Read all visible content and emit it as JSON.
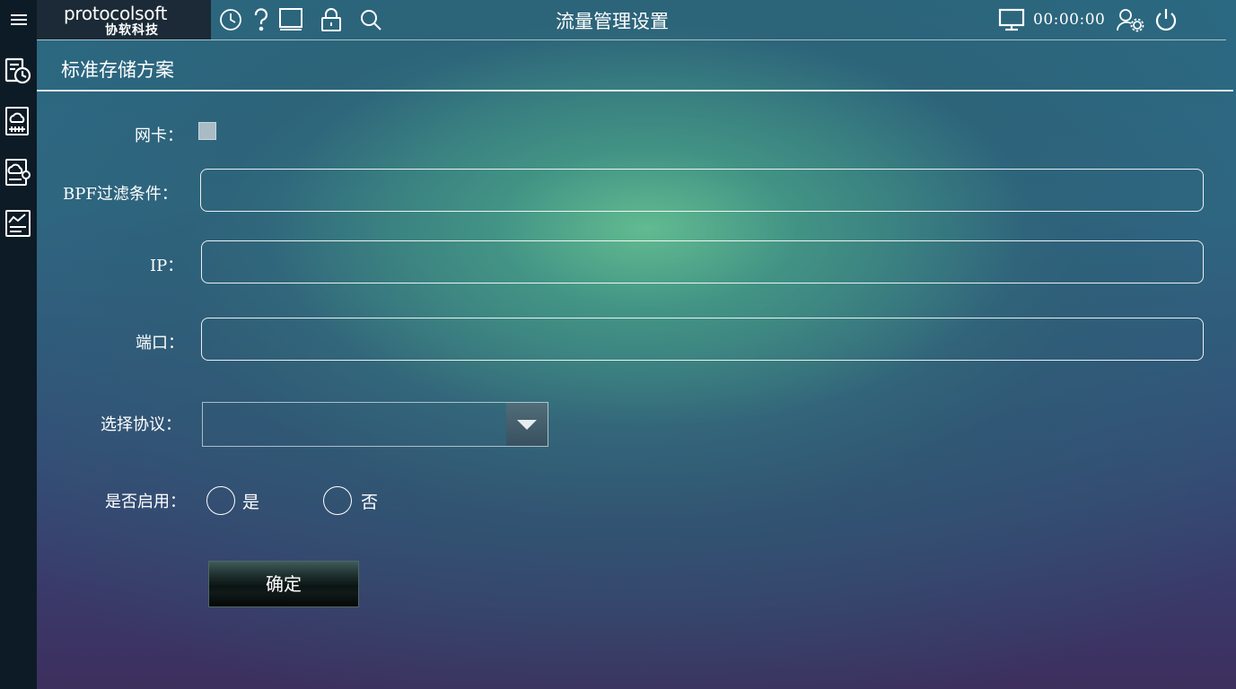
{
  "topbar": {
    "logo_en": "protocolsoft",
    "logo_cn": "协软科技",
    "title": "流量管理设置",
    "time": "00:00:00"
  },
  "section": {
    "title": "标准存储方案"
  },
  "form": {
    "nic_label": "网卡：",
    "bpf_label": "BPF过滤条件：",
    "bpf_value": "",
    "ip_label": "IP：",
    "ip_value": "",
    "port_label": "端口：",
    "port_value": "",
    "protocol_label": "选择协议：",
    "protocol_value": "",
    "enable_label": "是否启用：",
    "yes_label": "是",
    "no_label": "否",
    "submit_label": "确定"
  }
}
